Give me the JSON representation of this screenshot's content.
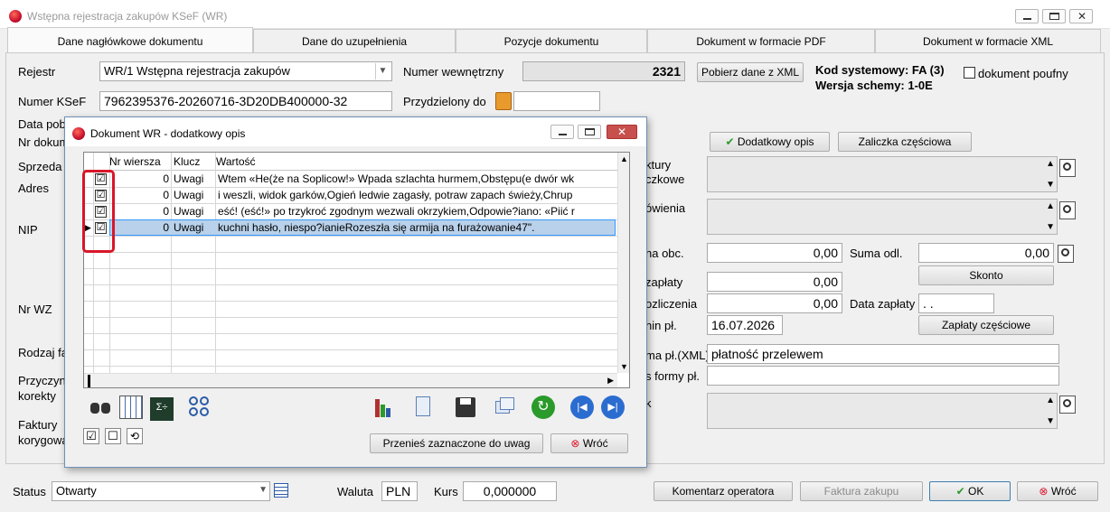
{
  "window": {
    "title": "Wstępna rejestracja zakupów KSeF (WR)"
  },
  "tabs": [
    "Dane nagłówkowe dokumentu",
    "Dane do uzupełnienia",
    "Pozycje dokumentu",
    "Dokument w formacie PDF",
    "Dokument w formacie XML"
  ],
  "form": {
    "rejestr_label": "Rejestr",
    "rejestr_value": "WR/1 Wstępna rejestracja zakupów",
    "numer_wew_label": "Numer wewnętrzny",
    "numer_wew_value": "2321",
    "pobierz_btn": "Pobierz dane z XML",
    "kod_systemowy": "Kod systemowy: FA (3)",
    "wersja_schemy": "Wersja schemy: 1-0E",
    "poufny_label": "dokument poufny",
    "numer_ksef_label": "Numer KSeF",
    "numer_ksef_value": "7962395376-20260716-3D20DB400000-32",
    "przydzielony_label": "Przydzielony do",
    "data_pob_label": "Data pob",
    "nr_dokum_label": "Nr dokum",
    "sprzeda_label": "Sprzeda",
    "adres_label": "Adres",
    "nip_label": "NIP",
    "nr_wz_label": "Nr WZ",
    "rodzaj_label": "Rodzaj fa",
    "przyczyna_label": "Przyczyn",
    "korekty_label": "korekty",
    "faktury_label": "Faktury",
    "korygowa_label": "korygowa",
    "dodatkowy_opis_btn": "Dodatkowy opis",
    "zaliczka_btn": "Zaliczka częściowa",
    "faktury_r_label": "ktury",
    "czkowe_label": "czkowe",
    "owienia_label": "ówienia",
    "na_obc_label": "na obc.",
    "suma_obc_value": "0,00",
    "suma_odl_label": "Suma odl.",
    "suma_odl_value": "0,00",
    "skonto_btn": "Skonto",
    "zaplaty_label": "zapłaty",
    "zaplaty_value": "0,00",
    "rozliczenia_label": "ozliczenia",
    "rozliczenia_value": "0,00",
    "data_zaplaty_label": "Data zapłaty",
    "data_zaplaty_value": ". .",
    "min_pl_label": "nin pł.",
    "termin_value": "16.07.2026",
    "zaplaty_czesc_btn": "Zapłaty częściowe",
    "forma_xml_label": "ma pł.(XML)",
    "forma_xml_value": "płatność przelewem",
    "s_formy_label": "s formy pł.",
    "k_label": "k"
  },
  "status_bar": {
    "status_label": "Status",
    "status_value": "Otwarty",
    "waluta_label": "Waluta",
    "waluta_value": "PLN",
    "kurs_label": "Kurs",
    "kurs_value": "0,000000",
    "komentarz_btn": "Komentarz operatora",
    "faktura_btn": "Faktura zakupu",
    "ok_btn": "OK",
    "wroc_btn": "Wróć"
  },
  "dialog": {
    "title": "Dokument WR - dodatkowy opis",
    "columns": [
      "Nr wiersza",
      "Klucz",
      "Wartość"
    ],
    "rows": [
      {
        "checked": "☑",
        "nr": "0",
        "klucz": "Uwagi",
        "wartosc": "Wtem «He(że na Soplicow!» Wpada szlachta hurmem,Obstępu(e dwór wk"
      },
      {
        "checked": "☑",
        "nr": "0",
        "klucz": "Uwagi",
        "wartosc": "i weszli, widok garków,Ogień ledwie zagasły, potraw zapach świeży,Chrup"
      },
      {
        "checked": "☑",
        "nr": "0",
        "klucz": "Uwagi",
        "wartosc": "eść! (eść!» po trzykroć zgodnym wezwali okrzykiem,Odpowie?iano: «Piić r"
      },
      {
        "checked": "☑",
        "nr": "0",
        "klucz": "Uwagi",
        "wartosc": "kuchni hasło, niespo?ianieRozeszła się armija na furażowanie47\"."
      }
    ],
    "przenies_btn": "Przenieś zaznaczone do uwag",
    "wroc_btn": "Wróć"
  },
  "colors": {
    "selected_row": "#b9d1ea",
    "highlight": "#d9162a",
    "dialog_border": "#6f8fb5"
  }
}
